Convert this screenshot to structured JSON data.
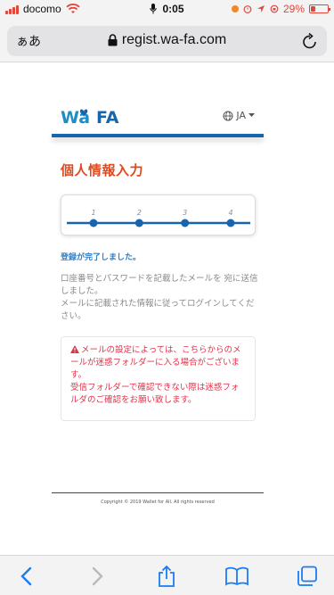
{
  "status_bar": {
    "carrier": "docomo",
    "time": "0:05",
    "battery": "29%",
    "battery_level": 0.29
  },
  "browser": {
    "aa_label": "ぁあ",
    "url": "regist.wa-fa.com"
  },
  "header": {
    "logo_text": "WaFA",
    "language": "JA"
  },
  "page": {
    "title": "個人情報入力",
    "steps": [
      "1",
      "2",
      "3",
      "4"
    ],
    "success_message": "登録が完了しました。",
    "info_lines": [
      "口座番号とパスワードを記載したメールを 宛に送信しました。",
      "メールに記載された情報に従ってログインしてください。"
    ],
    "warning_lines": [
      "メールの設定によっては、こちらからのメールが迷惑フォルダーに入る場合がございます。",
      "受信フォルダーで確認できない際は迷惑フォルダのご確認をお願い致します。"
    ]
  },
  "footer": {
    "copyright": "Copyright © 2019 Wallet for All. All rights reserved"
  },
  "colors": {
    "brand_blue": "#1766ad",
    "title_orange": "#e04a1e",
    "warning_red": "#e0344a",
    "success_blue": "#2d7fc9"
  },
  "icons": [
    "wifi-icon",
    "mic-icon",
    "lock-icon",
    "reload-icon",
    "globe-icon",
    "caret-down-icon",
    "warning-icon",
    "back-icon",
    "forward-icon",
    "share-icon",
    "bookmarks-icon",
    "tabs-icon"
  ]
}
